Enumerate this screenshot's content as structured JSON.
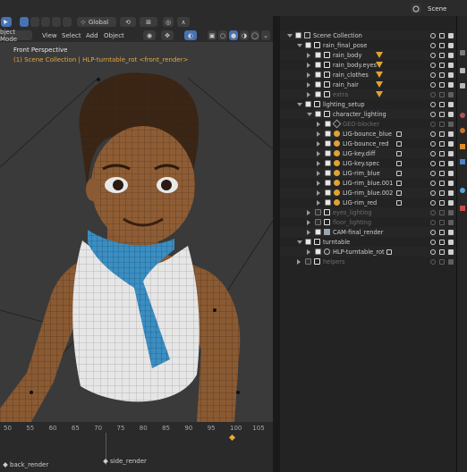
{
  "topbar": {
    "scene_label": "Scene",
    "mode_label": "bject Mode",
    "menu": [
      "View",
      "Select",
      "Add",
      "Object"
    ],
    "transform_orientation": "Global",
    "search_placeholder": ""
  },
  "viewport": {
    "title": "Front Perspective",
    "subtitle": "(1) Scene Collection | HLP-turntable_rot <front_render>"
  },
  "outliner": {
    "rows": [
      {
        "depth": 0,
        "label": "Scene Collection",
        "expanded": true,
        "checked": true,
        "kind": "scene",
        "dim": false
      },
      {
        "depth": 1,
        "label": "rain_final_pose",
        "expanded": true,
        "checked": true,
        "kind": "collection",
        "dim": false
      },
      {
        "depth": 2,
        "label": "rain_body",
        "expanded": false,
        "checked": true,
        "kind": "collection",
        "dim": false
      },
      {
        "depth": 2,
        "label": "rain_body.eyes",
        "expanded": false,
        "checked": true,
        "kind": "collection",
        "dim": false
      },
      {
        "depth": 2,
        "label": "rain_clothes",
        "expanded": false,
        "checked": true,
        "kind": "collection",
        "dim": false
      },
      {
        "depth": 2,
        "label": "rain_hair",
        "expanded": false,
        "checked": true,
        "kind": "collection",
        "dim": false
      },
      {
        "depth": 2,
        "label": "extra",
        "expanded": false,
        "checked": true,
        "kind": "collection",
        "dim": true
      },
      {
        "depth": 1,
        "label": "lighting_setup",
        "expanded": true,
        "checked": true,
        "kind": "collection",
        "dim": false
      },
      {
        "depth": 2,
        "label": "character_lighting",
        "expanded": true,
        "checked": true,
        "kind": "collection",
        "dim": false
      },
      {
        "depth": 3,
        "label": "GEO-blocker",
        "expanded": false,
        "checked": true,
        "kind": "mesh",
        "dim": true
      },
      {
        "depth": 3,
        "label": "LIG-bounce_blue",
        "expanded": false,
        "checked": true,
        "kind": "light",
        "dim": false
      },
      {
        "depth": 3,
        "label": "LIG-bounce_red",
        "expanded": false,
        "checked": true,
        "kind": "light",
        "dim": false
      },
      {
        "depth": 3,
        "label": "LIG-key.diff",
        "expanded": false,
        "checked": true,
        "kind": "light",
        "dim": false
      },
      {
        "depth": 3,
        "label": "LIG-key.spec",
        "expanded": false,
        "checked": true,
        "kind": "light",
        "dim": false
      },
      {
        "depth": 3,
        "label": "LIG-rim_blue",
        "expanded": false,
        "checked": true,
        "kind": "light",
        "dim": false
      },
      {
        "depth": 3,
        "label": "LIG-rim_blue.001",
        "expanded": false,
        "checked": true,
        "kind": "light",
        "dim": false
      },
      {
        "depth": 3,
        "label": "LIG-rim_blue.002",
        "expanded": false,
        "checked": true,
        "kind": "light",
        "dim": false
      },
      {
        "depth": 3,
        "label": "LIG-rim_red",
        "expanded": false,
        "checked": true,
        "kind": "light",
        "dim": false
      },
      {
        "depth": 2,
        "label": "eyes_lighting",
        "expanded": false,
        "checked": false,
        "kind": "collection",
        "dim": true
      },
      {
        "depth": 2,
        "label": "floor_lighting",
        "expanded": false,
        "checked": false,
        "kind": "collection",
        "dim": true
      },
      {
        "depth": 2,
        "label": "CAM-final_render",
        "expanded": false,
        "checked": true,
        "kind": "camera",
        "dim": false
      },
      {
        "depth": 1,
        "label": "turntable",
        "expanded": true,
        "checked": true,
        "kind": "collection",
        "dim": false
      },
      {
        "depth": 2,
        "label": "HLP-turntable_rot",
        "expanded": false,
        "checked": true,
        "kind": "empty",
        "dim": false
      },
      {
        "depth": 1,
        "label": "helpers",
        "expanded": false,
        "checked": false,
        "kind": "collection",
        "dim": true
      }
    ]
  },
  "timeline": {
    "ticks": [
      "50",
      "55",
      "60",
      "65",
      "70",
      "75",
      "80",
      "85",
      "90",
      "95",
      "100",
      "105"
    ],
    "markers": [
      {
        "label": "back_render"
      },
      {
        "label": "side_render"
      }
    ]
  },
  "colors": {
    "accent": "#4772b3",
    "light_icon": "#e0a234",
    "viewport_bg": "#3a3a3a",
    "skin": "#8a5a33",
    "hair": "#3b2616",
    "top": "#e6e6e6",
    "scarf": "#3b8ec2"
  }
}
